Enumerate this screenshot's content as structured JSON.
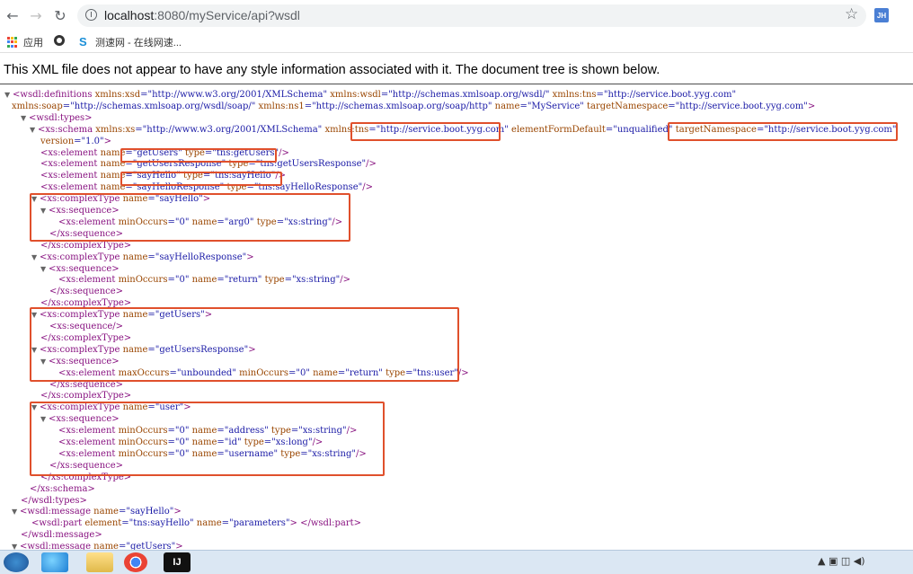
{
  "browser": {
    "back_icon": "←",
    "forward_icon": "→",
    "reload_icon": "↻",
    "url_host": "localhost",
    "url_rest": ":8080/myService/api?wsdl",
    "star_icon": "☆",
    "avatar_initials": "JH"
  },
  "bookmarks": [
    {
      "label": "应用"
    },
    {
      "label": ""
    },
    {
      "label": "测速网 - 在线网速..."
    }
  ],
  "notice": "This XML file does not appear to have any style information associated with it. The document tree is shown below.",
  "xml_lines": [
    [
      {
        "t": "▼",
        "c": "tw"
      },
      {
        "t": "<wsdl:definitions",
        "c": "tg"
      },
      {
        "t": " xmlns:xsd",
        "c": "an"
      },
      {
        "t": "=\"http://www.w3.org/2001/XMLSchema\"",
        "c": "av"
      },
      {
        "t": " xmlns:wsdl",
        "c": "an"
      },
      {
        "t": "=\"http://schemas.xmlsoap.org/wsdl/\"",
        "c": "av"
      },
      {
        "t": " xmlns:tns",
        "c": "an"
      },
      {
        "t": "=\"http://service.boot.yyg.com\"",
        "c": "av"
      }
    ],
    [
      {
        "t": "xmlns:soap",
        "c": "an"
      },
      {
        "t": "=\"http://schemas.xmlsoap.org/wsdl/soap/\"",
        "c": "av"
      },
      {
        "t": " xmlns:ns1",
        "c": "an"
      },
      {
        "t": "=\"http://schemas.xmlsoap.org/soap/http\"",
        "c": "av"
      },
      {
        "t": " name",
        "c": "an"
      },
      {
        "t": "=\"MyService\"",
        "c": "av"
      },
      {
        "t": " targetNamespace",
        "c": "an"
      },
      {
        "t": "=\"http://service.boot.yyg.com\"",
        "c": "av"
      },
      {
        "t": ">",
        "c": "tg"
      }
    ],
    [
      {
        "t": "▼",
        "c": "tw"
      },
      {
        "t": "<wsdl:types>",
        "c": "tg"
      }
    ],
    [
      {
        "t": "▼",
        "c": "tw"
      },
      {
        "t": "<xs:schema",
        "c": "tg"
      },
      {
        "t": " xmlns:xs",
        "c": "an"
      },
      {
        "t": "=\"http://www.w3.org/2001/XMLSchema\"",
        "c": "av"
      },
      {
        "t": " xmlns:tns",
        "c": "an"
      },
      {
        "t": "=\"http://service.boot.yyg.com\"",
        "c": "av"
      },
      {
        "t": " elementFormDefault",
        "c": "an"
      },
      {
        "t": "=\"unqualified\"",
        "c": "av"
      },
      {
        "t": " targetNamespace",
        "c": "an"
      },
      {
        "t": "=\"http://service.boot.yyg.com\"",
        "c": "av"
      }
    ],
    [
      {
        "t": "version",
        "c": "an"
      },
      {
        "t": "=\"1.0\"",
        "c": "av"
      },
      {
        "t": ">",
        "c": "tg"
      }
    ],
    [
      {
        "t": "<xs:element",
        "c": "tg"
      },
      {
        "t": " name",
        "c": "an"
      },
      {
        "t": "=\"getUsers\"",
        "c": "av"
      },
      {
        "t": " type",
        "c": "an"
      },
      {
        "t": "=\"tns:getUsers\"",
        "c": "av"
      },
      {
        "t": "/>",
        "c": "tg"
      }
    ],
    [
      {
        "t": "<xs:element",
        "c": "tg"
      },
      {
        "t": " name",
        "c": "an"
      },
      {
        "t": "=\"getUsersResponse\"",
        "c": "av"
      },
      {
        "t": " type",
        "c": "an"
      },
      {
        "t": "=\"tns:getUsersResponse\"",
        "c": "av"
      },
      {
        "t": "/>",
        "c": "tg"
      }
    ],
    [
      {
        "t": "<xs:element",
        "c": "tg"
      },
      {
        "t": " name",
        "c": "an"
      },
      {
        "t": "=\"sayHello\"",
        "c": "av"
      },
      {
        "t": " type",
        "c": "an"
      },
      {
        "t": "=\"tns:sayHello\"",
        "c": "av"
      },
      {
        "t": "/>",
        "c": "tg"
      }
    ],
    [
      {
        "t": "<xs:element",
        "c": "tg"
      },
      {
        "t": " name",
        "c": "an"
      },
      {
        "t": "=\"sayHelloResponse\"",
        "c": "av"
      },
      {
        "t": " type",
        "c": "an"
      },
      {
        "t": "=\"tns:sayHelloResponse\"",
        "c": "av"
      },
      {
        "t": "/>",
        "c": "tg"
      }
    ],
    [
      {
        "t": "▼",
        "c": "tw"
      },
      {
        "t": "<xs:complexType",
        "c": "tg"
      },
      {
        "t": " name",
        "c": "an"
      },
      {
        "t": "=\"sayHello\"",
        "c": "av"
      },
      {
        "t": ">",
        "c": "tg"
      }
    ],
    [
      {
        "t": "▼",
        "c": "tw"
      },
      {
        "t": "<xs:sequence>",
        "c": "tg"
      }
    ],
    [
      {
        "t": "<xs:element",
        "c": "tg"
      },
      {
        "t": " minOccurs",
        "c": "an"
      },
      {
        "t": "=\"0\"",
        "c": "av"
      },
      {
        "t": " name",
        "c": "an"
      },
      {
        "t": "=\"arg0\"",
        "c": "av"
      },
      {
        "t": " type",
        "c": "an"
      },
      {
        "t": "=\"xs:string\"",
        "c": "av"
      },
      {
        "t": "/>",
        "c": "tg"
      }
    ],
    [
      {
        "t": "</xs:sequence>",
        "c": "tg"
      }
    ],
    [
      {
        "t": "</xs:complexType>",
        "c": "tg"
      }
    ],
    [
      {
        "t": "▼",
        "c": "tw"
      },
      {
        "t": "<xs:complexType",
        "c": "tg"
      },
      {
        "t": " name",
        "c": "an"
      },
      {
        "t": "=\"sayHelloResponse\"",
        "c": "av"
      },
      {
        "t": ">",
        "c": "tg"
      }
    ],
    [
      {
        "t": "▼",
        "c": "tw"
      },
      {
        "t": "<xs:sequence>",
        "c": "tg"
      }
    ],
    [
      {
        "t": "<xs:element",
        "c": "tg"
      },
      {
        "t": " minOccurs",
        "c": "an"
      },
      {
        "t": "=\"0\"",
        "c": "av"
      },
      {
        "t": " name",
        "c": "an"
      },
      {
        "t": "=\"return\"",
        "c": "av"
      },
      {
        "t": " type",
        "c": "an"
      },
      {
        "t": "=\"xs:string\"",
        "c": "av"
      },
      {
        "t": "/>",
        "c": "tg"
      }
    ],
    [
      {
        "t": "</xs:sequence>",
        "c": "tg"
      }
    ],
    [
      {
        "t": "</xs:complexType>",
        "c": "tg"
      }
    ],
    [
      {
        "t": "▼",
        "c": "tw"
      },
      {
        "t": "<xs:complexType",
        "c": "tg"
      },
      {
        "t": " name",
        "c": "an"
      },
      {
        "t": "=\"getUsers\"",
        "c": "av"
      },
      {
        "t": ">",
        "c": "tg"
      }
    ],
    [
      {
        "t": "<xs:sequence/>",
        "c": "tg"
      }
    ],
    [
      {
        "t": "</xs:complexType>",
        "c": "tg"
      }
    ],
    [
      {
        "t": "▼",
        "c": "tw"
      },
      {
        "t": "<xs:complexType",
        "c": "tg"
      },
      {
        "t": " name",
        "c": "an"
      },
      {
        "t": "=\"getUsersResponse\"",
        "c": "av"
      },
      {
        "t": ">",
        "c": "tg"
      }
    ],
    [
      {
        "t": "▼",
        "c": "tw"
      },
      {
        "t": "<xs:sequence>",
        "c": "tg"
      }
    ],
    [
      {
        "t": "<xs:element",
        "c": "tg"
      },
      {
        "t": " maxOccurs",
        "c": "an"
      },
      {
        "t": "=\"unbounded\"",
        "c": "av"
      },
      {
        "t": " minOccurs",
        "c": "an"
      },
      {
        "t": "=\"0\"",
        "c": "av"
      },
      {
        "t": " name",
        "c": "an"
      },
      {
        "t": "=\"return\"",
        "c": "av"
      },
      {
        "t": " type",
        "c": "an"
      },
      {
        "t": "=\"tns:user\"",
        "c": "av"
      },
      {
        "t": "/>",
        "c": "tg"
      }
    ],
    [
      {
        "t": "</xs:sequence>",
        "c": "tg"
      }
    ],
    [
      {
        "t": "</xs:complexType>",
        "c": "tg"
      }
    ],
    [
      {
        "t": "▼",
        "c": "tw"
      },
      {
        "t": "<xs:complexType",
        "c": "tg"
      },
      {
        "t": " name",
        "c": "an"
      },
      {
        "t": "=\"user\"",
        "c": "av"
      },
      {
        "t": ">",
        "c": "tg"
      }
    ],
    [
      {
        "t": "▼",
        "c": "tw"
      },
      {
        "t": "<xs:sequence>",
        "c": "tg"
      }
    ],
    [
      {
        "t": "<xs:element",
        "c": "tg"
      },
      {
        "t": " minOccurs",
        "c": "an"
      },
      {
        "t": "=\"0\"",
        "c": "av"
      },
      {
        "t": " name",
        "c": "an"
      },
      {
        "t": "=\"address\"",
        "c": "av"
      },
      {
        "t": " type",
        "c": "an"
      },
      {
        "t": "=\"xs:string\"",
        "c": "av"
      },
      {
        "t": "/>",
        "c": "tg"
      }
    ],
    [
      {
        "t": "<xs:element",
        "c": "tg"
      },
      {
        "t": " minOccurs",
        "c": "an"
      },
      {
        "t": "=\"0\"",
        "c": "av"
      },
      {
        "t": " name",
        "c": "an"
      },
      {
        "t": "=\"id\"",
        "c": "av"
      },
      {
        "t": " type",
        "c": "an"
      },
      {
        "t": "=\"xs:long\"",
        "c": "av"
      },
      {
        "t": "/>",
        "c": "tg"
      }
    ],
    [
      {
        "t": "<xs:element",
        "c": "tg"
      },
      {
        "t": " minOccurs",
        "c": "an"
      },
      {
        "t": "=\"0\"",
        "c": "av"
      },
      {
        "t": " name",
        "c": "an"
      },
      {
        "t": "=\"username\"",
        "c": "av"
      },
      {
        "t": " type",
        "c": "an"
      },
      {
        "t": "=\"xs:string\"",
        "c": "av"
      },
      {
        "t": "/>",
        "c": "tg"
      }
    ],
    [
      {
        "t": "</xs:sequence>",
        "c": "tg"
      }
    ],
    [
      {
        "t": "</xs:complexType>",
        "c": "tg"
      }
    ],
    [
      {
        "t": "</xs:schema>",
        "c": "tg"
      }
    ],
    [
      {
        "t": "</wsdl:types>",
        "c": "tg"
      }
    ],
    [
      {
        "t": "▼",
        "c": "tw"
      },
      {
        "t": "<wsdl:message",
        "c": "tg"
      },
      {
        "t": " name",
        "c": "an"
      },
      {
        "t": "=\"sayHello\"",
        "c": "av"
      },
      {
        "t": ">",
        "c": "tg"
      }
    ],
    [
      {
        "t": "<wsdl:part",
        "c": "tg"
      },
      {
        "t": " element",
        "c": "an"
      },
      {
        "t": "=\"tns:sayHello\"",
        "c": "av"
      },
      {
        "t": " name",
        "c": "an"
      },
      {
        "t": "=\"parameters\"",
        "c": "av"
      },
      {
        "t": ">",
        "c": "tg"
      },
      {
        "t": " </wsdl:part>",
        "c": "tg"
      }
    ],
    [
      {
        "t": "</wsdl:message>",
        "c": "tg"
      }
    ],
    [
      {
        "t": "▼",
        "c": "tw"
      },
      {
        "t": "<wsdl:message",
        "c": "tg"
      },
      {
        "t": " name",
        "c": "an"
      },
      {
        "t": "=\"getUsers\"",
        "c": "av"
      },
      {
        "t": ">",
        "c": "tg"
      }
    ]
  ],
  "colors": {
    "tag": "#881280",
    "attr_name": "#994500",
    "attr_value": "#1a1aa6",
    "highlight_box": "#e0502c"
  },
  "taskbar": {
    "items": [
      "start-orb-icon",
      "ie-icon",
      "folder-icon",
      "chrome-icon",
      "intellij-icon"
    ],
    "intellij_label": "IJ"
  }
}
